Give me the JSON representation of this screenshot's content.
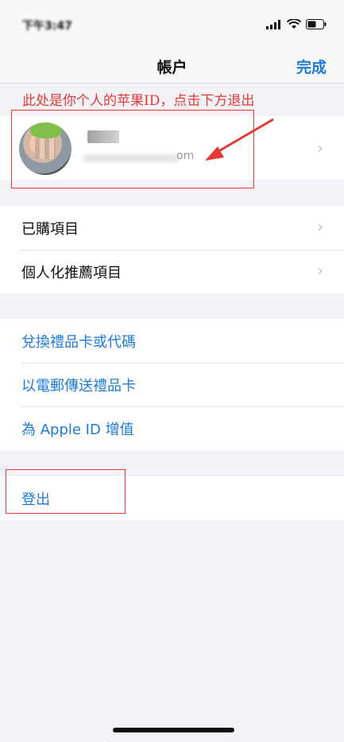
{
  "status": {
    "time": "下午3:47"
  },
  "nav": {
    "title": "帳户",
    "done": "完成"
  },
  "annotation": {
    "text": "此处是你个人的苹果ID，点击下方退出"
  },
  "profile": {
    "email_suffix": "om"
  },
  "section1": [
    {
      "label": "已購項目"
    },
    {
      "label": "個人化推薦項目"
    }
  ],
  "section2": [
    {
      "label": "兌換禮品卡或代碼"
    },
    {
      "label": "以電郵傳送禮品卡"
    },
    {
      "label": "為 Apple ID 增值"
    }
  ],
  "logout": {
    "label": "登出"
  },
  "colors": {
    "link": "#1d7bd8",
    "annotation": "#e53935"
  }
}
